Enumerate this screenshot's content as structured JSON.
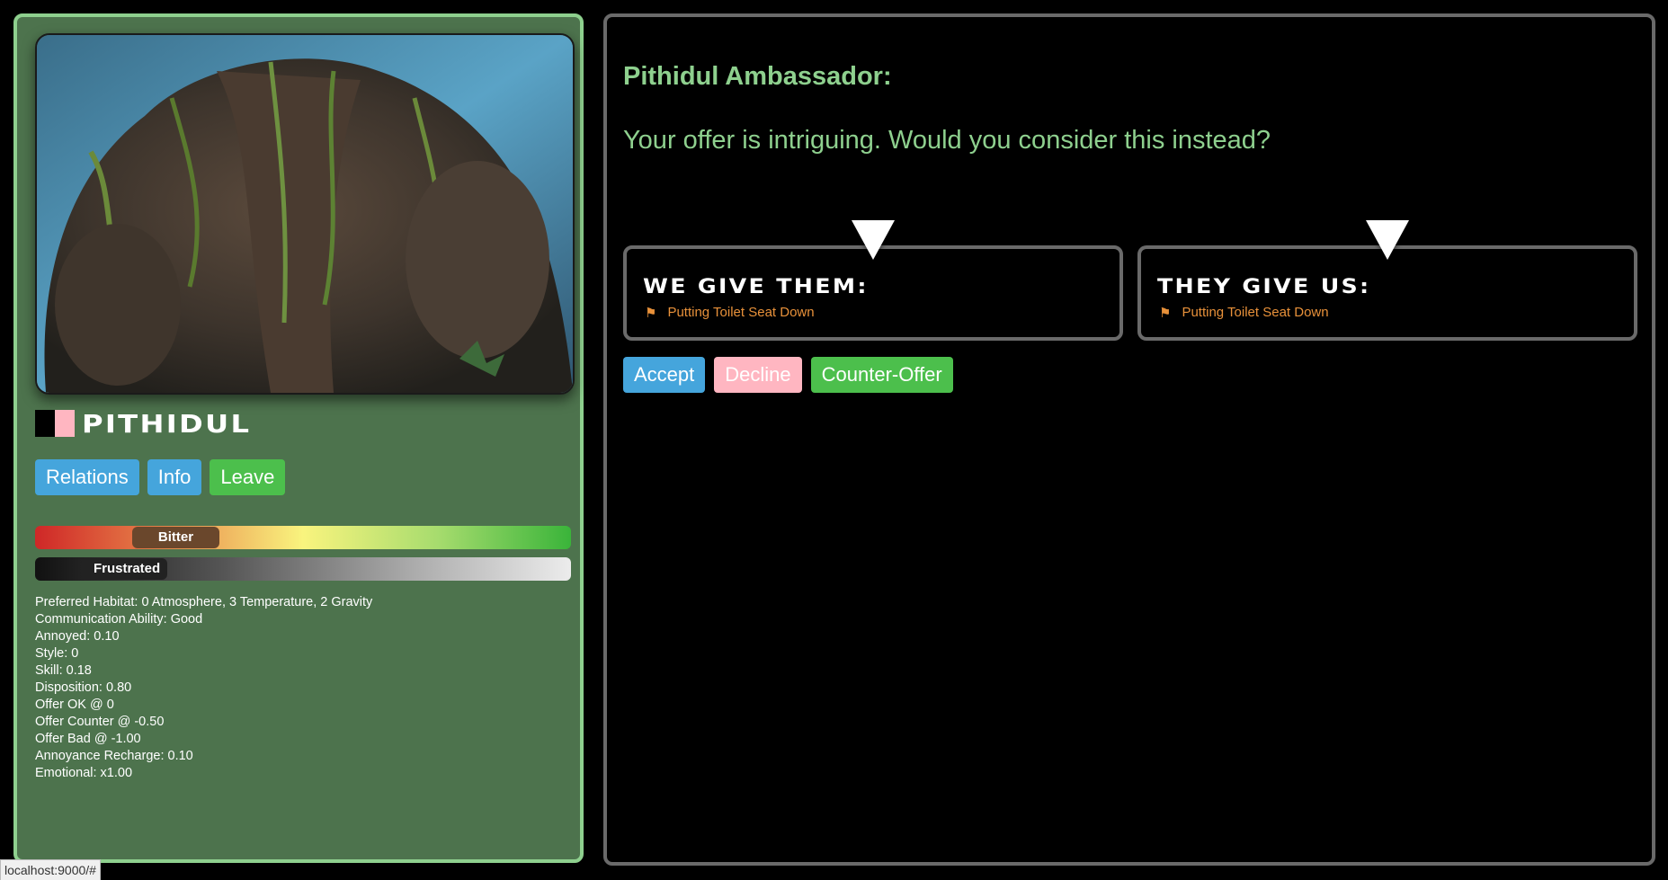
{
  "race": {
    "name": "Pithidul"
  },
  "flag": {
    "colors": [
      "#000000",
      "#ffb6c1"
    ]
  },
  "left_buttons": {
    "relations": "Relations",
    "info": "Info",
    "leave": "Leave"
  },
  "meters": {
    "attitude": {
      "label": "Bitter",
      "level": 0.26
    },
    "mood": {
      "label": "Frustrated",
      "level": 0.16
    }
  },
  "stats": [
    "Preferred Habitat: 0 Atmosphere, 3 Temperature, 2 Gravity",
    "Communication Ability: Good",
    "Annoyed: 0.10",
    "Style: 0",
    "Skill: 0.18",
    "Disposition: 0.80",
    "Offer OK @ 0",
    "Offer Counter @ -0.50",
    "Offer Bad @ -1.00",
    "Annoyance Recharge: 0.10",
    "Emotional: x1.00"
  ],
  "dialog": {
    "speaker": "Pithidul Ambassador:",
    "message": "Your offer is intriguing. Would you consider this instead?"
  },
  "deal": {
    "we_give": {
      "title": "We give them:",
      "items": [
        "Putting Toilet Seat Down"
      ]
    },
    "they_give": {
      "title": "They give us:",
      "items": [
        "Putting Toilet Seat Down"
      ]
    }
  },
  "actions": {
    "accept": "Accept",
    "decline": "Decline",
    "counter": "Counter-Offer"
  },
  "status_bar": {
    "url": "localhost:9000/#"
  },
  "colors": {
    "accent_green": "#8ed08e",
    "panel_green": "#4d734d",
    "item_orange": "#e8913a",
    "button_blue": "#45a5dc",
    "button_green": "#4cbf4c",
    "button_pink": "#ffb6c1"
  }
}
